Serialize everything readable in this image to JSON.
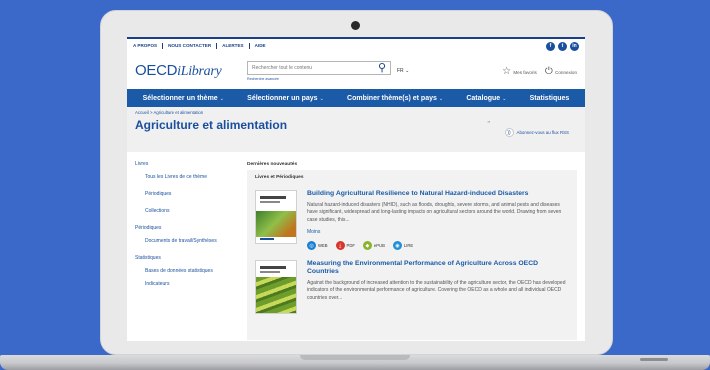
{
  "topbar": {
    "links": [
      "A PROPOS",
      "NOUS CONTACTER",
      "ALERTES",
      "AIDE"
    ],
    "social": [
      {
        "icon": "facebook-icon",
        "glyph": "f"
      },
      {
        "icon": "twitter-icon",
        "glyph": "t"
      },
      {
        "icon": "linkedin-icon",
        "glyph": "in"
      }
    ]
  },
  "header": {
    "logo_oecd": "OECD",
    "logo_library": "iLibrary",
    "search_placeholder": "Rechercher tout le contenu",
    "advanced_search": "Recherche avancée",
    "language": "FR",
    "favorites": "Mes favoris",
    "login": "Connexion"
  },
  "nav": {
    "items": [
      {
        "label": "Sélectionner un thème",
        "dropdown": true
      },
      {
        "label": "Sélectionner un pays",
        "dropdown": true
      },
      {
        "label": "Combiner thème(s) et pays",
        "dropdown": true
      },
      {
        "label": "Catalogue",
        "dropdown": true
      },
      {
        "label": "Statistiques",
        "dropdown": false
      }
    ]
  },
  "titlebar": {
    "breadcrumb": "Accueil > Agriculture et alimentation",
    "title": "Agriculture et alimentation",
    "rss": "Abonnez-vous au flux RSS"
  },
  "sidebar": {
    "sections": [
      {
        "label": "Livres",
        "items": [
          "Tous les Livres de ce thème",
          "Périodiques",
          "Collections"
        ]
      },
      {
        "label": "Périodiques",
        "items": [
          "Documents de travail/Synthèses"
        ]
      },
      {
        "label": "Statistiques",
        "items": [
          "Bases de données statistiques",
          "Indicateurs"
        ]
      }
    ]
  },
  "main": {
    "heading": "Dernières nouveautés",
    "panel_title": "Livres et Périodiques",
    "items": [
      {
        "title": "Building Agricultural Resilience to Natural Hazard-induced Disasters",
        "description": "Natural hazard-induced disasters (NHID), such as floods, droughts, severe storms, and animal pests and diseases have significant, widespread and long-lasting impacts on agricultural sectors around the world. Drawing from seven case studies, this...",
        "toggle": "Moins",
        "formats": [
          {
            "label": "WEB",
            "icon": "globe-icon",
            "color": "#1a7fd1",
            "glyph": "◎"
          },
          {
            "label": "PDF",
            "icon": "pdf-icon",
            "color": "#d9362b",
            "glyph": "⤓"
          },
          {
            "label": "ePUB",
            "icon": "epub-icon",
            "color": "#8ab22a",
            "glyph": "◆"
          },
          {
            "label": "LIRE",
            "icon": "read-icon",
            "color": "#1f8fd6",
            "glyph": "◉"
          }
        ]
      },
      {
        "title": "Measuring the Environmental Performance of Agriculture Across OECD Countries",
        "description": "Against the background of increased attention to the sustainability of the agriculture sector, the OECD has developed indicators of the environmental performance of agriculture. Covering the OECD as a whole and all individual OECD countries over..."
      }
    ]
  }
}
